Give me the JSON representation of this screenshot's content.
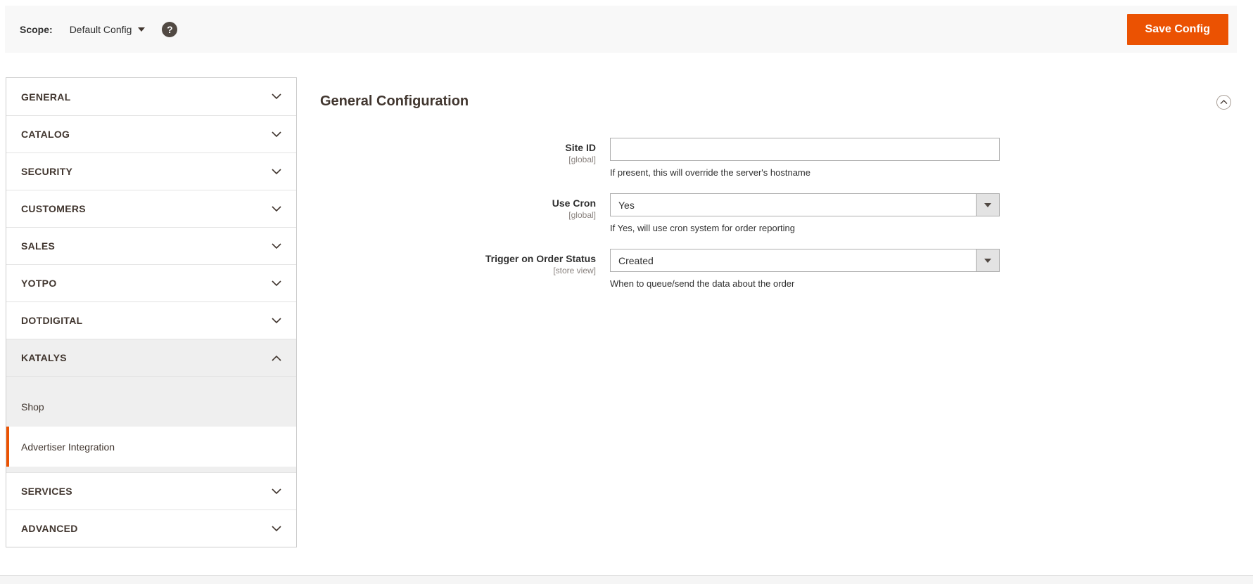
{
  "toolbar": {
    "scope_label": "Scope:",
    "scope_value": "Default Config",
    "save_button_label": "Save Config"
  },
  "icons": {
    "scope_caret": "caret-down",
    "help": "question-mark-in-circle",
    "help_glyph": "?",
    "section_collapsed": "chevron-down",
    "section_expanded": "chevron-up",
    "panel_collapse": "chevron-up-in-circle",
    "select_caret": "caret-down"
  },
  "sidebar": {
    "sections": [
      {
        "label": "GENERAL",
        "state": "collapsed"
      },
      {
        "label": "CATALOG",
        "state": "collapsed"
      },
      {
        "label": "SECURITY",
        "state": "collapsed"
      },
      {
        "label": "CUSTOMERS",
        "state": "collapsed"
      },
      {
        "label": "SALES",
        "state": "collapsed"
      },
      {
        "label": "YOTPO",
        "state": "collapsed"
      },
      {
        "label": "DOTDIGITAL",
        "state": "collapsed"
      },
      {
        "label": "KATALYS",
        "state": "expanded",
        "children": [
          {
            "label": "Shop",
            "active": false
          },
          {
            "label": "Advertiser Integration",
            "active": true
          }
        ]
      },
      {
        "label": "SERVICES",
        "state": "collapsed"
      },
      {
        "label": "ADVANCED",
        "state": "collapsed"
      }
    ]
  },
  "main": {
    "section_title": "General Configuration",
    "fields": [
      {
        "label": "Site ID",
        "scope": "[global]",
        "type": "text",
        "value": "",
        "note": "If present, this will override the server's hostname"
      },
      {
        "label": "Use Cron",
        "scope": "[global]",
        "type": "select",
        "value": "Yes",
        "note": "If Yes, will use cron system for order reporting"
      },
      {
        "label": "Trigger on Order Status",
        "scope": "[store view]",
        "type": "select",
        "value": "Created",
        "note": "When to queue/send the data about the order"
      }
    ]
  },
  "colors": {
    "accent": "#eb5202",
    "toolbar_bg": "#f8f8f8",
    "sidebar_expanded_bg": "#efefef",
    "panel_border": "#cccccc",
    "input_border": "#adadad",
    "select_button_bg": "#e3e3e3",
    "text_dark": "#41362f",
    "scope_tag_text": "#8a837f"
  }
}
